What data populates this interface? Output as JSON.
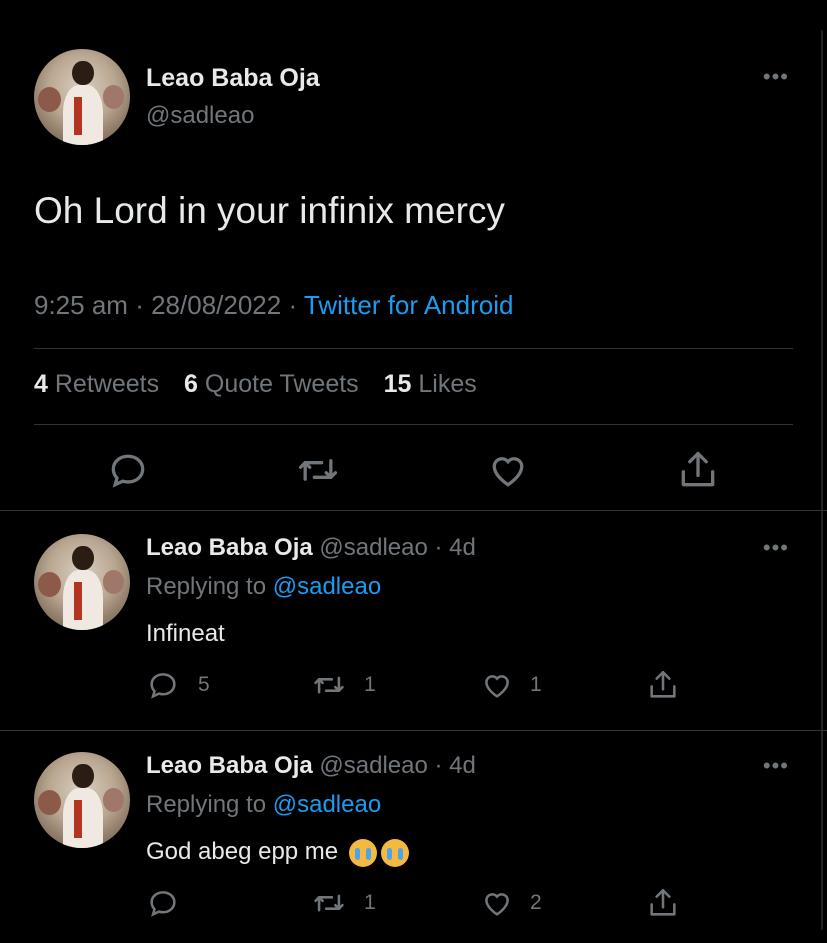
{
  "tweet": {
    "author_name": "Leao Baba Oja",
    "author_handle": "@sadleao",
    "text": "Oh Lord in your infinix mercy",
    "time": "9:25 am",
    "date": "28/08/2022",
    "sep": "·",
    "source": "Twitter for Android",
    "stats": {
      "retweets_count": "4",
      "retweets_label": "Retweets",
      "quotes_count": "6",
      "quotes_label": "Quote Tweets",
      "likes_count": "15",
      "likes_label": "Likes"
    }
  },
  "more_label": "•••",
  "replies": [
    {
      "author_name": "Leao Baba Oja",
      "author_handle": "@sadleao",
      "age": "· 4d",
      "replying_prefix": "Replying to",
      "replying_to": "@sadleao",
      "text": "Infineat",
      "reply_count": "5",
      "retweet_count": "1",
      "like_count": "1"
    },
    {
      "author_name": "Leao Baba Oja",
      "author_handle": "@sadleao",
      "age": "· 4d",
      "replying_prefix": "Replying to",
      "replying_to": "@sadleao",
      "text": "God abeg epp me",
      "reply_count": "",
      "retweet_count": "1",
      "like_count": "2"
    }
  ],
  "icons": {
    "reply": "comment-icon",
    "retweet": "retweet-icon",
    "like": "heart-icon",
    "share": "share-icon",
    "emoji": "crying-face-emoji"
  }
}
